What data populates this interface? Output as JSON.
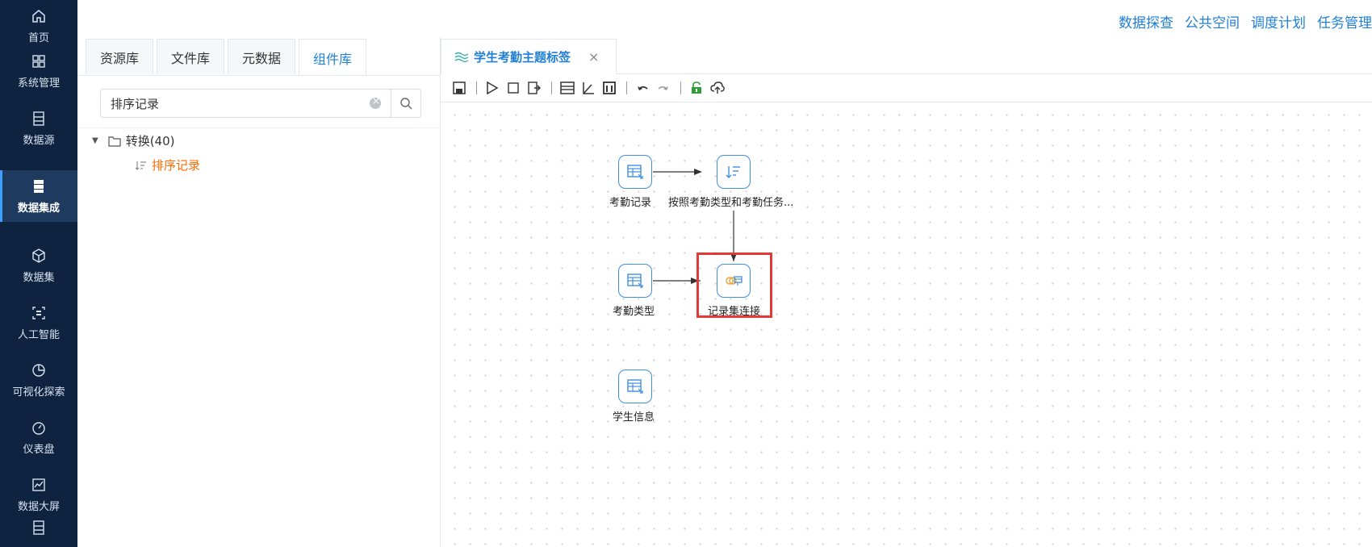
{
  "nav": [
    {
      "label": "首页",
      "icon": "home-icon"
    },
    {
      "label": "系统管理",
      "icon": "grid-icon"
    },
    {
      "label": "数据源",
      "icon": "database-icon"
    },
    {
      "label": "数据集成",
      "icon": "server-icon",
      "active": true
    },
    {
      "label": "数据集",
      "icon": "cube-icon"
    },
    {
      "label": "人工智能",
      "icon": "scan-icon"
    },
    {
      "label": "可视化探索",
      "icon": "pie-icon"
    },
    {
      "label": "仪表盘",
      "icon": "gauge-icon"
    },
    {
      "label": "数据大屏",
      "icon": "trend-icon"
    },
    {
      "label": "",
      "icon": "database-icon"
    }
  ],
  "top_links": [
    "数据探查",
    "公共空间",
    "调度计划",
    "任务管理"
  ],
  "left_panel": {
    "tabs": [
      "资源库",
      "文件库",
      "元数据",
      "组件库"
    ],
    "active_tab": "组件库",
    "search": {
      "value": "排序记录",
      "placeholder": ""
    },
    "tree": {
      "root_label": "转换(40)",
      "child_label": "排序记录"
    }
  },
  "editor": {
    "tab_title": "学生考勤主题标签",
    "close_glyph": "×",
    "canvas_nodes": {
      "attendance_record": "考勤记录",
      "sort_by": "按照考勤类型和考勤任务...",
      "attendance_type": "考勤类型",
      "record_join": "记录集连接",
      "student_info": "学生信息"
    }
  },
  "colors": {
    "accent": "#1f7fd6",
    "nav_bg": "#0d2340",
    "highlight": "#e53935",
    "tree_match": "#ff6a00"
  }
}
